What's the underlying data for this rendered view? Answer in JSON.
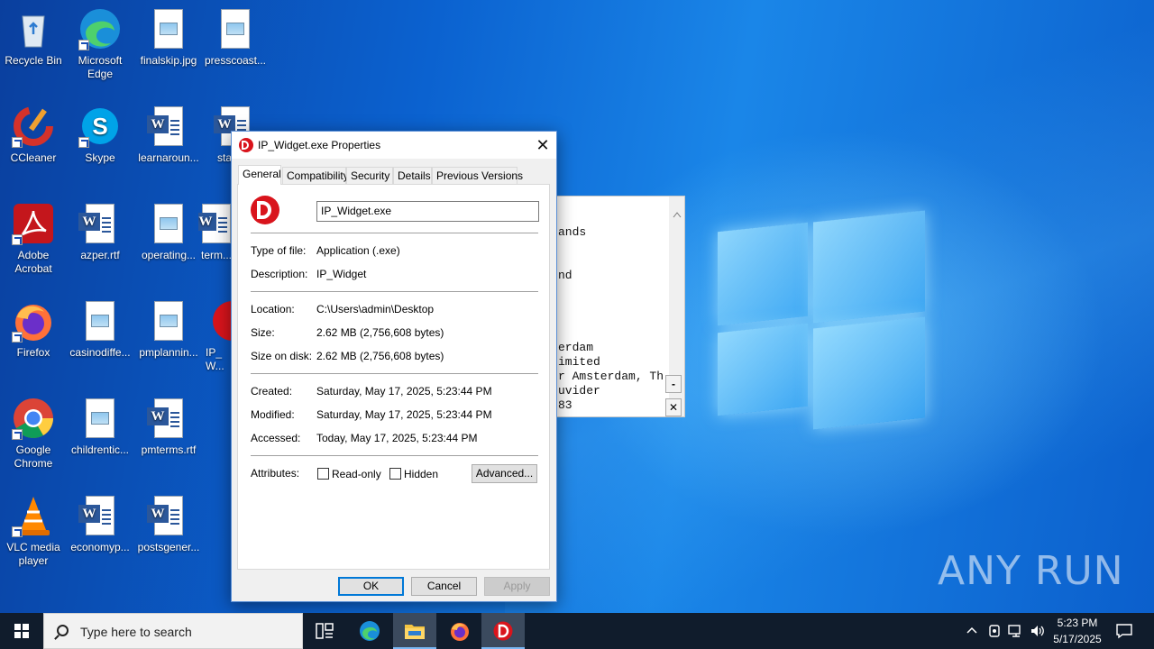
{
  "desktop": {
    "icons": [
      {
        "label": "Recycle Bin"
      },
      {
        "label": "Microsoft Edge"
      },
      {
        "label": "finalskip.jpg"
      },
      {
        "label": "presscoast..."
      },
      {
        "label": "CCleaner"
      },
      {
        "label": "Skype"
      },
      {
        "label": "learnaroun..."
      },
      {
        "label": "starte..."
      },
      {
        "label": "Adobe Acrobat"
      },
      {
        "label": "azper.rtf"
      },
      {
        "label": "operating..."
      },
      {
        "label": "term..."
      },
      {
        "label": "Firefox"
      },
      {
        "label": "casinodiffe..."
      },
      {
        "label": "pmplannin..."
      },
      {
        "label": "IP_W..."
      },
      {
        "label": "Google Chrome"
      },
      {
        "label": "childrentic..."
      },
      {
        "label": "pmterms.rtf"
      },
      {
        "label": "VLC media player"
      },
      {
        "label": "economyp..."
      },
      {
        "label": "postsgener..."
      }
    ]
  },
  "background_window": {
    "lines": [
      "ands",
      "",
      "",
      "nd",
      "",
      "",
      "",
      "",
      "erdam",
      "imited",
      "r Amsterdam, Th",
      "uvider",
      "83"
    ],
    "minus": "-",
    "close": "✕"
  },
  "dialog": {
    "title": "IP_Widget.exe Properties",
    "close_glyph": "✕",
    "tabs": [
      "General",
      "Compatibility",
      "Security",
      "Details",
      "Previous Versions"
    ],
    "file_name": "IP_Widget.exe",
    "type_label": "Type of file:",
    "type_value": "Application (.exe)",
    "description_label": "Description:",
    "description_value": "IP_Widget",
    "location_label": "Location:",
    "location_value": "C:\\Users\\admin\\Desktop",
    "size_label": "Size:",
    "size_value": "2.62 MB (2,756,608 bytes)",
    "size_on_disk_label": "Size on disk:",
    "size_on_disk_value": "2.62 MB (2,756,608 bytes)",
    "created_label": "Created:",
    "created_value": "Saturday, May 17, 2025, 5:23:44 PM",
    "modified_label": "Modified:",
    "modified_value": "Saturday, May 17, 2025, 5:23:44 PM",
    "accessed_label": "Accessed:",
    "accessed_value": "Today, May 17, 2025, 5:23:44 PM",
    "attributes_label": "Attributes:",
    "readonly_label": "Read-only",
    "hidden_label": "Hidden",
    "advanced_button": "Advanced...",
    "ok_button": "OK",
    "cancel_button": "Cancel",
    "apply_button": "Apply"
  },
  "taskbar": {
    "search_placeholder": "Type here to search",
    "time": "5:23 PM",
    "date": "5/17/2025"
  },
  "watermark": "ANY RUN",
  "colors": {
    "accent": "#0078d7",
    "taskbar": "#101c2c",
    "app_icon_red": "#d9141c"
  }
}
